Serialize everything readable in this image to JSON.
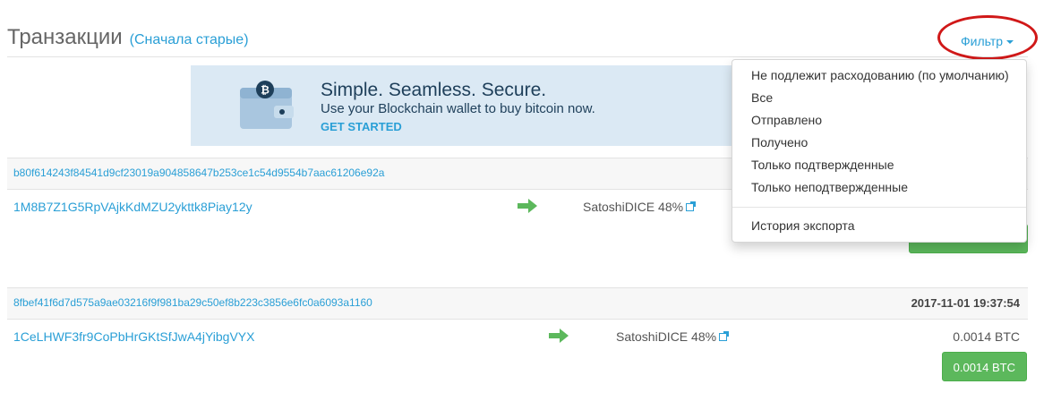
{
  "header": {
    "title": "Транзакции",
    "sort_link": "(Сначала старые)",
    "filter_label": "Фильтр"
  },
  "banner": {
    "title": "Simple. Seamless. Secure.",
    "subtitle": "Use your Blockchain wallet to buy bitcoin now.",
    "cta": "GET STARTED"
  },
  "filter_menu": {
    "items": [
      "Не подлежит расходованию (по умолчанию)",
      "Все",
      "Отправлено",
      "Получено",
      "Только подтвержденные",
      "Только неподтвержденные"
    ],
    "export": "История экспорта"
  },
  "transactions": [
    {
      "hash": "b80f614243f84541d9cf23019a904858647b253ce1c54d9554b7aac61206e92a",
      "time": "",
      "from": "1M8B7Z1G5RpVAjkKdMZU2ykttk8Piay12y",
      "to": "SatoshiDICE 48%",
      "amount": "",
      "button": ""
    },
    {
      "hash": "8fbef41f6d7d575a9ae03216f9f981ba29c50ef8b223c3856e6fc0a6093a1160",
      "time": "2017-11-01 19:37:54",
      "from": "1CeLHWF3fr9CoPbHrGKtSfJwA4jYibgVYX",
      "to": "SatoshiDICE 48%",
      "amount": "0.0014 BTC",
      "button": "0.0014 BTC"
    }
  ]
}
